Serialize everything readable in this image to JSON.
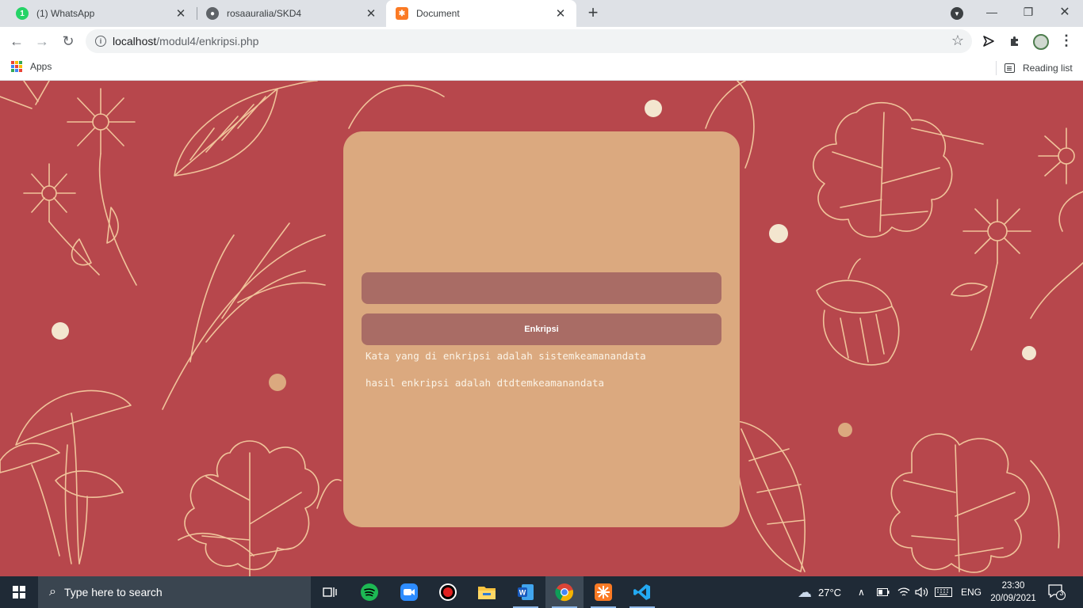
{
  "browser": {
    "tabs": [
      {
        "title": "(1) WhatsApp",
        "icon": "whatsapp-icon",
        "badge": "1",
        "active": false
      },
      {
        "title": "rosaauralia/SKD4",
        "icon": "github-icon",
        "active": false
      },
      {
        "title": "Document",
        "icon": "xampp-icon",
        "active": true
      }
    ],
    "url_host": "localhost",
    "url_path": "/modul4/enkripsi.php",
    "bookmarks": {
      "apps_label": "Apps",
      "reading_list_label": "Reading list"
    }
  },
  "page": {
    "input_value": "",
    "button_label": "Enkripsi",
    "result_plain": "Kata yang di enkripsi adalah sistemkeamanandata",
    "result_cipher": "hasil enkripsi adalah dtdtemkeamanandata",
    "colors": {
      "background": "#b7474c",
      "card": "#dba97f",
      "field": "#a96c65",
      "line_art": "#f0c39a"
    }
  },
  "taskbar": {
    "search_placeholder": "Type here to search",
    "apps": [
      "task-view-icon",
      "spotify-icon",
      "zoom-icon",
      "recorder-icon",
      "file-explorer-icon",
      "word-icon",
      "chrome-icon",
      "xampp-icon",
      "vscode-icon"
    ],
    "weather": "27°C",
    "language": "ENG",
    "time": "23:30",
    "date": "20/09/2021",
    "notification_count": "3"
  }
}
